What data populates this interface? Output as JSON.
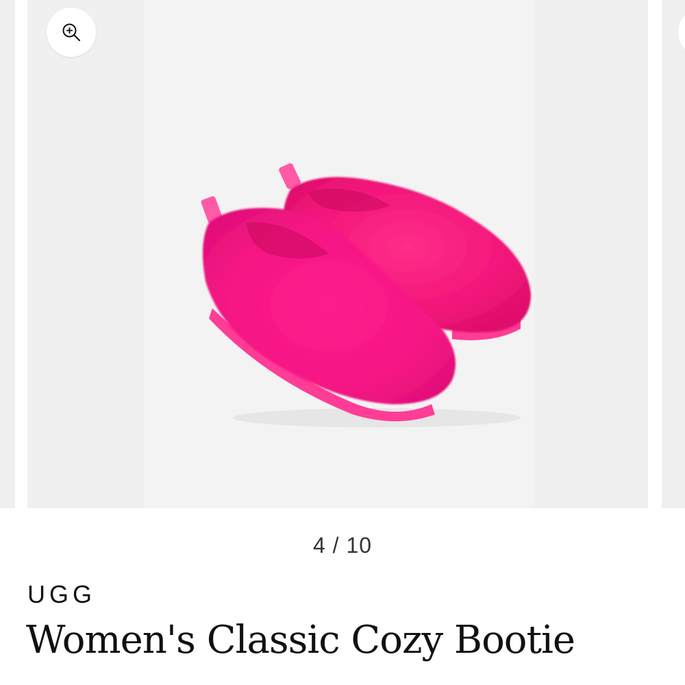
{
  "gallery": {
    "current": 4,
    "total": 10,
    "counter_text": "4 / 10",
    "zoom_icon": "zoom-in-icon"
  },
  "product": {
    "brand": "UGG",
    "title": "Women's Classic Cozy Bootie",
    "image_alt": "Pink fluffy UGG slippers",
    "color": "#ff1a8c"
  }
}
